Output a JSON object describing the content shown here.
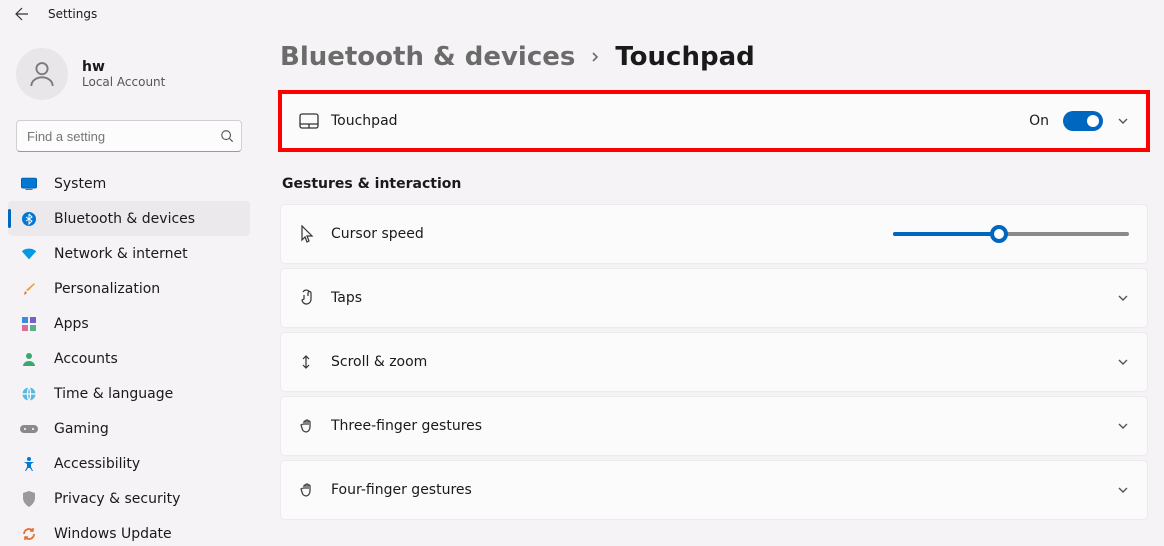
{
  "titlebar": {
    "title": "Settings"
  },
  "profile": {
    "name": "hw",
    "subtitle": "Local Account"
  },
  "search": {
    "placeholder": "Find a setting"
  },
  "nav": {
    "items": [
      {
        "label": "System",
        "icon": "system"
      },
      {
        "label": "Bluetooth & devices",
        "icon": "bluetooth",
        "active": true
      },
      {
        "label": "Network & internet",
        "icon": "wifi"
      },
      {
        "label": "Personalization",
        "icon": "brush"
      },
      {
        "label": "Apps",
        "icon": "apps"
      },
      {
        "label": "Accounts",
        "icon": "accounts"
      },
      {
        "label": "Time & language",
        "icon": "time"
      },
      {
        "label": "Gaming",
        "icon": "gaming"
      },
      {
        "label": "Accessibility",
        "icon": "accessibility"
      },
      {
        "label": "Privacy & security",
        "icon": "privacy"
      },
      {
        "label": "Windows Update",
        "icon": "update"
      }
    ]
  },
  "breadcrumb": {
    "parent": "Bluetooth & devices",
    "current": "Touchpad"
  },
  "touchpad_main": {
    "label": "Touchpad",
    "state_label": "On",
    "state": true
  },
  "section": {
    "label": "Gestures & interaction"
  },
  "cursor_speed": {
    "label": "Cursor speed",
    "value": 45,
    "max": 100
  },
  "cards": [
    {
      "label": "Taps"
    },
    {
      "label": "Scroll & zoom"
    },
    {
      "label": "Three-finger gestures"
    },
    {
      "label": "Four-finger gestures"
    }
  ]
}
